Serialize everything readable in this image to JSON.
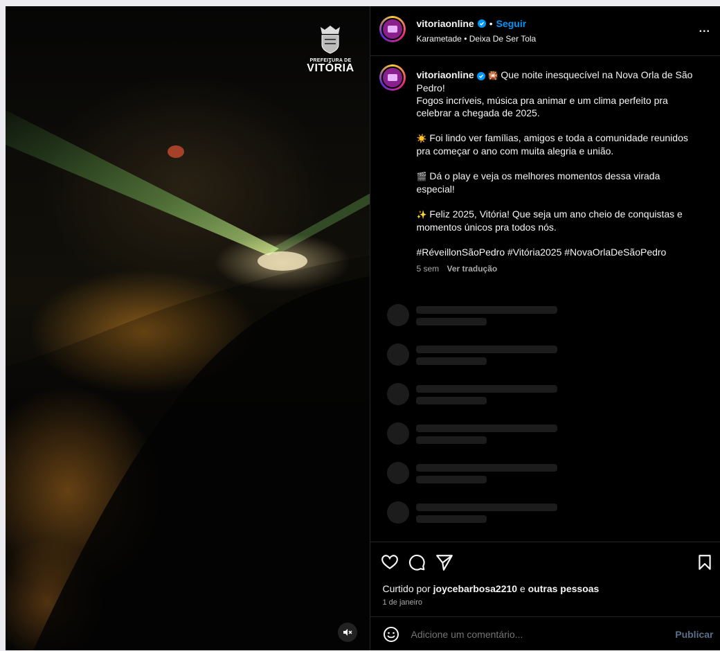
{
  "media": {
    "logo_small": "PREFEITURA DE",
    "logo_big": "VITÓRIA",
    "mute_icon": "speaker-muted-icon"
  },
  "header": {
    "username": "vitoriaonline",
    "separator": "•",
    "follow_label": "Seguir",
    "audio": "Karametade • Deixa De Ser Tola",
    "more_label": "..."
  },
  "caption": {
    "username": "vitoriaonline",
    "line1": "Que noite inesquecível na Nova Orla de São Pedro!",
    "line2": "Fogos incríveis, música pra animar e um clima perfeito pra celebrar a chegada de 2025.",
    "para2": "Foi lindo ver famílias, amigos e toda a comunidade reunidos pra começar o ano com muita alegria e união.",
    "para3": "Dá o play e veja os melhores momentos dessa virada especial!",
    "para4": "Feliz 2025, Vitória! Que seja um ano cheio de conquistas e momentos únicos pra todos nós.",
    "hashtags": "#RéveillonSãoPedro #Vitória2025 #NovaOrlaDeSãoPedro",
    "age": "5 sem",
    "translate": "Ver tradução"
  },
  "likes": {
    "prefix": "Curtido por",
    "user": "joycebarbosa2210",
    "middle": "e",
    "others": "outras pessoas"
  },
  "date": "1 de janeiro",
  "comment": {
    "placeholder": "Adicione um comentário...",
    "publish_label": "Publicar"
  },
  "colors": {
    "accent": "#0095f6",
    "background": "#000000",
    "border": "#262626",
    "muted_text": "#a8a8a8"
  }
}
